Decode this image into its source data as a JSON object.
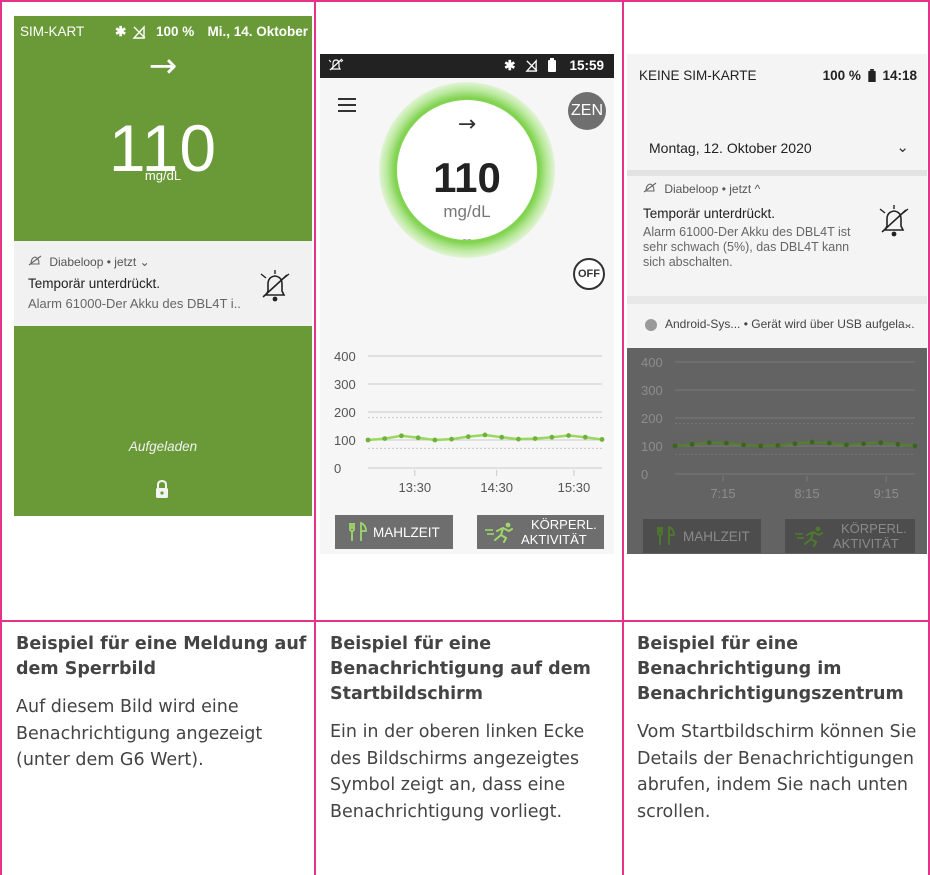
{
  "colors": {
    "accent": "#e6338a",
    "lock_green": "#6a9a37",
    "glucose_green": "#7fd24e"
  },
  "lockscreen": {
    "status_left": "SIM-KART",
    "status_battery": "100 %",
    "status_date": "Mi., 14. Oktober",
    "trend_arrow": "→",
    "glucose_value": "110",
    "glucose_unit": "mg/dL",
    "notification": {
      "app": "Diabeloop • jetzt ⌄",
      "title": "Temporär unterdrückt.",
      "body": "Alarm 61000-Der Akku des DBL4T i.."
    },
    "charged_label": "Aufgeladen"
  },
  "home": {
    "status_time": "15:59",
    "zen_label": "ZEN",
    "trend_arrow": "→",
    "glucose_value": "110",
    "glucose_unit": "mg/dL",
    "dash": "--",
    "off_label": "OFF",
    "meal_button": "MAHLZEIT",
    "activity_button_line1": "KÖRPERL.",
    "activity_button_line2": "AKTIVITÄT"
  },
  "notification_center": {
    "status_left": "KEINE SIM-KARTE",
    "status_right": "100 %",
    "status_time": "14:18",
    "date": "Montag, 12. Oktober 2020",
    "notification": {
      "app": "Diabeloop • jetzt ^",
      "title": "Temporär unterdrückt.",
      "body": "Alarm 61000-Der Akku des DBL4T ist sehr schwach (5%), das DBL4T kann sich abschalten."
    },
    "system_notification": "Android-Sys... • Gerät wird über USB aufgela...",
    "meal_button": "MAHLZEIT",
    "activity_button_line1": "KÖRPERL.",
    "activity_button_line2": "AKTIVITÄT"
  },
  "chart_data": [
    {
      "type": "line",
      "x": [
        "13:30",
        "14:30",
        "15:30"
      ],
      "y_ticks": [
        400,
        300,
        200,
        100,
        0
      ],
      "ylim": [
        0,
        400
      ],
      "series": [
        {
          "values": [
            100,
            105,
            115,
            108,
            100,
            103,
            112,
            118,
            110,
            103,
            105,
            110,
            116,
            110,
            102
          ]
        }
      ]
    },
    {
      "type": "line",
      "x": [
        "7:15",
        "8:15",
        "9:15"
      ],
      "y_ticks": [
        400,
        300,
        200,
        100,
        0
      ],
      "ylim": [
        0,
        400
      ],
      "series": [
        {
          "values": [
            100,
            106,
            112,
            110,
            104,
            100,
            102,
            108,
            114,
            110,
            104,
            108,
            112,
            106,
            100
          ]
        }
      ]
    }
  ],
  "captions": [
    {
      "title": "Beispiel für eine Meldung auf dem Sperrbild",
      "text": "Auf diesem Bild wird eine Benachrichtigung angezeigt (unter dem G6 Wert)."
    },
    {
      "title": "Beispiel für eine Benachrichtigung auf dem Startbildschirm",
      "text": "Ein in der oberen linken Ecke des Bildschirms angezeigtes Symbol zeigt an, dass eine Benachrichtigung vorliegt."
    },
    {
      "title": "Beispiel für eine Benachrichtigung im Benachrichtigungszentrum",
      "text": "Vom Startbildschirm können Sie Details der Benachrichtigungen abrufen, indem Sie nach unten scrollen."
    }
  ]
}
